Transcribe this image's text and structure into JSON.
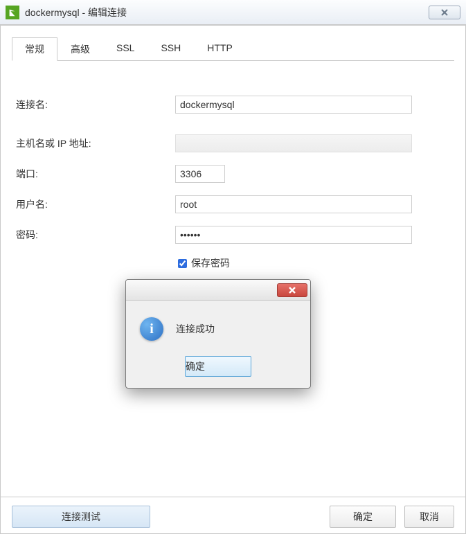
{
  "window": {
    "title": "dockermysql - 编辑连接"
  },
  "tabs": {
    "general": "常规",
    "advanced": "高级",
    "ssl": "SSL",
    "ssh": "SSH",
    "http": "HTTP"
  },
  "form": {
    "conn_name_label": "连接名:",
    "conn_name_value": "dockermysql",
    "host_label": "主机名或 IP 地址:",
    "host_value": "",
    "port_label": "端口:",
    "port_value": "3306",
    "user_label": "用户名:",
    "user_value": "root",
    "password_label": "密码:",
    "password_value": "••••••",
    "save_password_label": "保存密码"
  },
  "buttons": {
    "test": "连接测试",
    "ok": "确定",
    "cancel": "取消"
  },
  "dialog": {
    "message": "连接成功",
    "ok": "确定"
  }
}
